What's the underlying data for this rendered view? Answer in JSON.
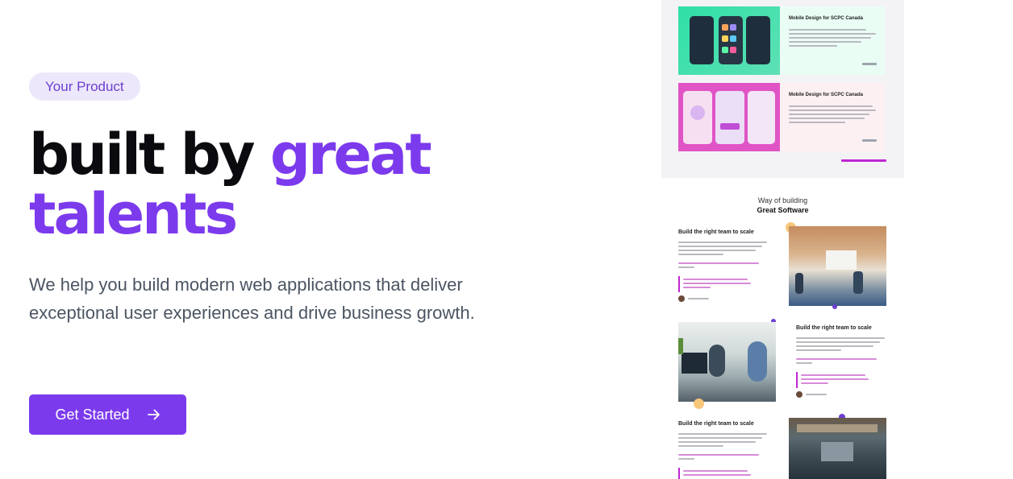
{
  "hero": {
    "badge": "Your Product",
    "headline_part1": "built by ",
    "headline_accent_1": "great",
    "headline_accent_2": "talents",
    "description": "We help you build modern web applications that deliver exceptional user experiences and drive business growth.",
    "cta_label": "Get Started",
    "cta_icon": "arrow-right-icon"
  },
  "colors": {
    "accent": "#7c3aed",
    "badge_bg": "#ede7fb",
    "heading": "#0b0b0f",
    "body_text": "#4b5563"
  },
  "preview": {
    "case_studies": [
      {
        "title": "Mobile Design for SCPC Canada"
      },
      {
        "title": "Mobile Design for SCPC Canada"
      }
    ],
    "section_title_line1": "Way of building",
    "section_title_line2": "Great Software",
    "steps": [
      {
        "title": "Build the right team to scale"
      },
      {
        "title": "Build the right team to scale"
      },
      {
        "title": "Build the right team to scale"
      }
    ]
  }
}
